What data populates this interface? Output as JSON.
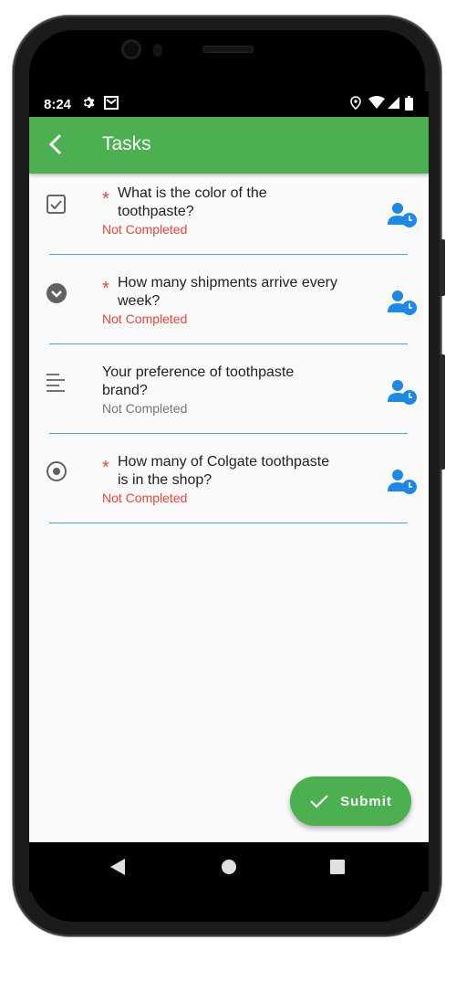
{
  "status_bar": {
    "time": "8:24",
    "icons": [
      "settings-icon",
      "gmail-icon",
      "location-icon",
      "wifi-icon",
      "signal-icon",
      "battery-icon"
    ]
  },
  "app_bar": {
    "title": "Tasks",
    "back_icon": "arrow-back-icon",
    "color": "#4caf50"
  },
  "tasks": [
    {
      "type_icon": "checkbox-icon",
      "required": true,
      "required_mark": "*",
      "question_line1": "What is the color of the",
      "question_line2": "toothpaste?",
      "status": "Not Completed",
      "status_color": "#f44336",
      "assign_icon": "user-clock-icon"
    },
    {
      "type_icon": "dropdown-circle-icon",
      "required": true,
      "required_mark": "*",
      "question_line1": "How many shipments arrive every",
      "question_line2": "week?",
      "status": "Not Completed",
      "status_color": "#f44336",
      "assign_icon": "user-clock-icon"
    },
    {
      "type_icon": "text-lines-icon",
      "required": false,
      "question_line1": "Your preference of toothpaste",
      "question_line2": "brand?",
      "status": "Not Completed",
      "status_color": "#757575",
      "assign_icon": "user-clock-icon"
    },
    {
      "type_icon": "radio-button-icon",
      "required": true,
      "required_mark": "*",
      "question_line1": "How many of Colgate toothpaste",
      "question_line2": "is in the shop?",
      "status": "Not Completed",
      "status_color": "#f44336",
      "assign_icon": "user-clock-icon"
    }
  ],
  "fab": {
    "label": "Submit",
    "icon": "check-icon"
  },
  "nav_bar": {
    "buttons": [
      "back-triangle-icon",
      "home-circle-icon",
      "recents-square-icon"
    ]
  }
}
